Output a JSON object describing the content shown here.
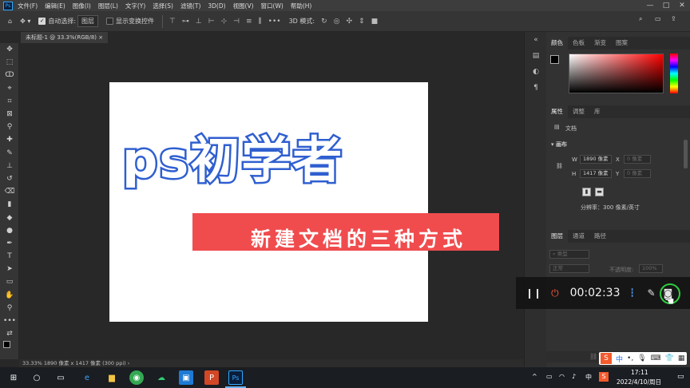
{
  "menubar": {
    "app_logo": "Ps",
    "items": [
      "文件(F)",
      "编辑(E)",
      "图像(I)",
      "图层(L)",
      "文字(Y)",
      "选择(S)",
      "滤镜(T)",
      "3D(D)",
      "视图(V)",
      "窗口(W)",
      "帮助(H)"
    ],
    "window_controls": [
      "—",
      "□",
      "✕"
    ]
  },
  "options_bar": {
    "auto_select_label": "自动选择:",
    "auto_select_value": "图层",
    "show_transform_label": "显示变换控件",
    "mode_3d_label": "3D 模式:"
  },
  "document": {
    "tab_title": "未标题-1 @ 33.3%(RGB/8)",
    "title_text": "ps初学者",
    "subtitle_text": "新建文档的三种方式",
    "status_text": "33.33%   1890 像素 x 1417 像素 (300 ppi)   ›"
  },
  "color_panel": {
    "tabs": [
      "颜色",
      "色板",
      "渐变",
      "图案"
    ]
  },
  "properties_panel": {
    "tabs": [
      "属性",
      "调整",
      "库"
    ],
    "doc_label": "文档",
    "section_label": "画布",
    "width_label": "W",
    "width_value": "1890 像素",
    "height_label": "H",
    "height_value": "1417 像素",
    "x_label": "X",
    "x_placeholder": "0 像素",
    "y_label": "Y",
    "y_placeholder": "0 像素",
    "resolution_text": "分辨率：300 像素/英寸"
  },
  "layers_panel": {
    "tabs": [
      "图层",
      "通道",
      "路径"
    ],
    "filter_placeholder": "类型",
    "blend_mode": "正常",
    "opacity_label": "不透明度:",
    "opacity_value": "100%"
  },
  "recorder": {
    "timer": "00:02:33"
  },
  "taskbar": {
    "time": "17:11",
    "date": "2022/4/10/周日",
    "ime_label": "中",
    "tray_ime": "中"
  }
}
